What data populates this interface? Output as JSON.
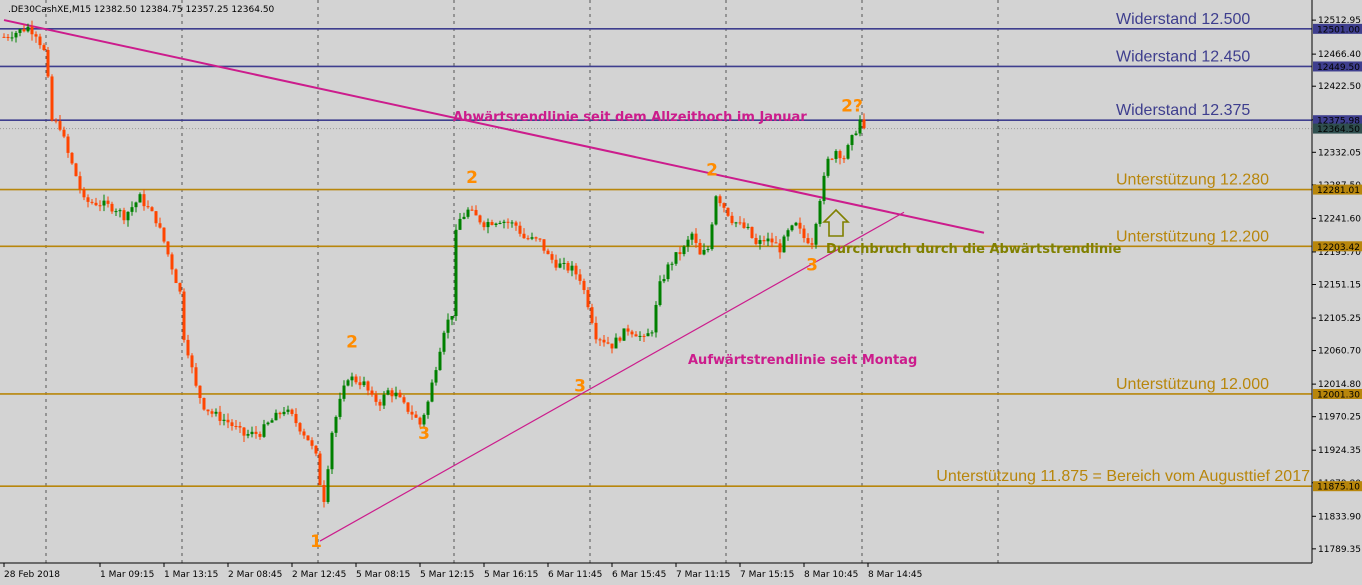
{
  "header": {
    "symbol_text": ".DE30CashXE,M15  12382.50 12384.75 12357.25 12364.50"
  },
  "chart_data": {
    "type": "candlestick",
    "ylim": [
      11770,
      12535
    ],
    "y_ticks": [
      "12512.95",
      "12466.40",
      "12422.50",
      "12376.45",
      "12332.05",
      "12287.50",
      "12241.60",
      "12195.70",
      "12151.15",
      "12105.25",
      "12060.70",
      "12014.80",
      "11970.25",
      "11924.35",
      "11879.80",
      "11833.90",
      "11789.35"
    ],
    "x_ticks": [
      {
        "label": "28 Feb 2018",
        "bar": 0
      },
      {
        "label": "1 Mar 09:15",
        "bar": 24
      },
      {
        "label": "1 Mar 13:15",
        "bar": 40
      },
      {
        "label": "2 Mar 08:45",
        "bar": 56
      },
      {
        "label": "2 Mar 12:45",
        "bar": 72
      },
      {
        "label": "5 Mar 08:15",
        "bar": 88
      },
      {
        "label": "5 Mar 12:15",
        "bar": 104
      },
      {
        "label": "5 Mar 16:15",
        "bar": 120
      },
      {
        "label": "6 Mar 11:45",
        "bar": 136
      },
      {
        "label": "6 Mar 15:45",
        "bar": 152
      },
      {
        "label": "7 Mar 11:15",
        "bar": 168
      },
      {
        "label": "7 Mar 15:15",
        "bar": 184
      },
      {
        "label": "8 Mar 10:45",
        "bar": 200
      },
      {
        "label": "8 Mar 14:45",
        "bar": 216
      }
    ],
    "session_separator_bars": [
      10,
      44,
      78,
      112,
      146,
      180,
      214,
      248
    ],
    "close_path": [
      [
        0,
        12490
      ],
      [
        6,
        12503
      ],
      [
        8,
        12495
      ],
      [
        10,
        12470
      ],
      [
        11,
        12430
      ],
      [
        12,
        12375
      ],
      [
        14,
        12368
      ],
      [
        16,
        12330
      ],
      [
        18,
        12300
      ],
      [
        20,
        12265
      ],
      [
        24,
        12262
      ],
      [
        28,
        12255
      ],
      [
        30,
        12245
      ],
      [
        34,
        12270
      ],
      [
        36,
        12255
      ],
      [
        38,
        12240
      ],
      [
        40,
        12210
      ],
      [
        42,
        12175
      ],
      [
        44,
        12140
      ],
      [
        45,
        12080
      ],
      [
        46,
        12060
      ],
      [
        48,
        12010
      ],
      [
        50,
        11985
      ],
      [
        52,
        11975
      ],
      [
        56,
        11963
      ],
      [
        60,
        11945
      ],
      [
        64,
        11948
      ],
      [
        66,
        11960
      ],
      [
        70,
        11980
      ],
      [
        72,
        11970
      ],
      [
        76,
        11940
      ],
      [
        78,
        11915
      ],
      [
        79,
        11880
      ],
      [
        80,
        11858
      ],
      [
        82,
        11950
      ],
      [
        84,
        11990
      ],
      [
        86,
        12025
      ],
      [
        88,
        12020
      ],
      [
        90,
        12015
      ],
      [
        92,
        11995
      ],
      [
        94,
        11990
      ],
      [
        96,
        12005
      ],
      [
        98,
        12000
      ],
      [
        100,
        11985
      ],
      [
        102,
        11975
      ],
      [
        104,
        11960
      ],
      [
        106,
        11990
      ],
      [
        108,
        12040
      ],
      [
        110,
        12090
      ],
      [
        112,
        12112
      ],
      [
        113,
        12220
      ],
      [
        114,
        12240
      ],
      [
        116,
        12252
      ],
      [
        120,
        12235
      ],
      [
        124,
        12240
      ],
      [
        128,
        12232
      ],
      [
        130,
        12215
      ],
      [
        134,
        12210
      ],
      [
        136,
        12190
      ],
      [
        138,
        12180
      ],
      [
        140,
        12175
      ],
      [
        142,
        12172
      ],
      [
        144,
        12160
      ],
      [
        146,
        12125
      ],
      [
        148,
        12082
      ],
      [
        150,
        12075
      ],
      [
        152,
        12068
      ],
      [
        154,
        12080
      ],
      [
        156,
        12090
      ],
      [
        158,
        12085
      ],
      [
        160,
        12075
      ],
      [
        162,
        12090
      ],
      [
        164,
        12150
      ],
      [
        166,
        12175
      ],
      [
        168,
        12190
      ],
      [
        170,
        12200
      ],
      [
        172,
        12220
      ],
      [
        174,
        12190
      ],
      [
        176,
        12200
      ],
      [
        178,
        12275
      ],
      [
        180,
        12258
      ],
      [
        182,
        12240
      ],
      [
        184,
        12232
      ],
      [
        186,
        12225
      ],
      [
        188,
        12205
      ],
      [
        190,
        12212
      ],
      [
        192,
        12210
      ],
      [
        194,
        12200
      ],
      [
        196,
        12222
      ],
      [
        198,
        12232
      ],
      [
        200,
        12215
      ],
      [
        202,
        12210
      ],
      [
        204,
        12270
      ],
      [
        206,
        12320
      ],
      [
        208,
        12335
      ],
      [
        210,
        12325
      ],
      [
        212,
        12350
      ],
      [
        214,
        12376
      ],
      [
        215,
        12365
      ]
    ],
    "horizontal_levels": [
      {
        "value": 12501.0,
        "tag": "12501.00",
        "label": "Widerstand 12.500",
        "color": "#3e3e8e"
      },
      {
        "value": 12449.5,
        "tag": "12449.50",
        "label": "Widerstand 12.450",
        "color": "#3e3e8e"
      },
      {
        "value": 12375.98,
        "tag": "12375.98",
        "label": "Widerstand 12.375",
        "color": "#3e3e8e"
      },
      {
        "value": 12281.01,
        "tag": "12281.01",
        "label": "Unterstützung 12.280",
        "color": "#b8860b"
      },
      {
        "value": 12203.42,
        "tag": "12203.42",
        "label": "Unterstützung 12.200",
        "color": "#b8860b"
      },
      {
        "value": 12001.3,
        "tag": "12001.30",
        "label": "Unterstützung 12.000",
        "color": "#b8860b"
      },
      {
        "value": 11875.1,
        "tag": "11875.10",
        "label": "Unterstützung 11.875 = Bereich vom Augusttief 2017",
        "color": "#b8860b"
      }
    ],
    "current_price": {
      "value": 12364.5,
      "tag": "12364.50"
    },
    "downtrend_line": {
      "from": [
        0,
        12513
      ],
      "to": [
        245,
        12222
      ],
      "label": "Abwärtsrendlinie seit dem Allzeithoch im Januar",
      "color": "#cc1c8c"
    },
    "uptrend_line": {
      "from": [
        79,
        11800
      ],
      "to": [
        225,
        12250
      ],
      "label": "Aufwärtstrendlinie seit Montag",
      "color": "#cc1c8c"
    },
    "breakout_annotation": {
      "label": "Durchbruch durch die Abwärtstrendlinie",
      "color": "#808000"
    },
    "wave_labels": [
      {
        "text": "1",
        "bar": 78,
        "value": 11792
      },
      {
        "text": "2",
        "bar": 87,
        "value": 12065
      },
      {
        "text": "3",
        "bar": 105,
        "value": 11940
      },
      {
        "text": "2",
        "bar": 117,
        "value": 12290
      },
      {
        "text": "3",
        "bar": 144,
        "value": 12005
      },
      {
        "text": "2",
        "bar": 177,
        "value": 12300
      },
      {
        "text": "3",
        "bar": 202,
        "value": 12170
      },
      {
        "text": "2?",
        "bar": 212,
        "value": 12388
      }
    ]
  }
}
